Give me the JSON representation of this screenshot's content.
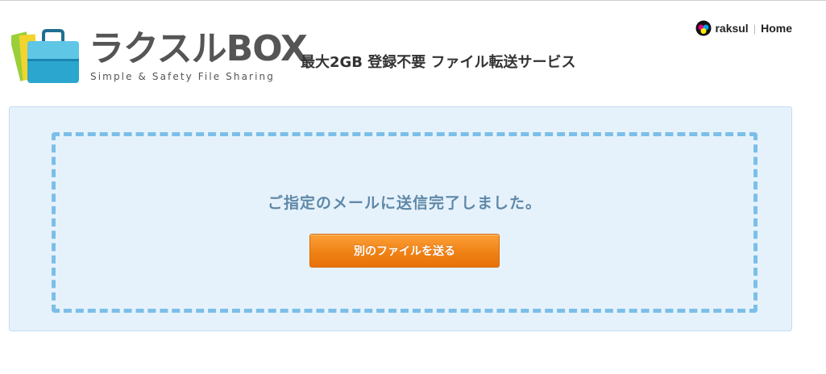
{
  "logo": {
    "name": "ラクスルBOX",
    "tagline": "Simple & Safety File Sharing",
    "icon": "briefcase-with-files-icon"
  },
  "header": {
    "service_description": "最大2GB 登録不要 ファイル転送サービス"
  },
  "nav": {
    "raksul_label": "raksul",
    "separator": "|",
    "home_label": "Home",
    "raksul_icon": "raksul-logo-icon"
  },
  "main": {
    "message": "ご指定のメールに送信完了しました。",
    "send_another_label": "別のファイルを送る"
  },
  "colors": {
    "panel_bg": "#e6f2fb",
    "dashed_border": "#7bbfe9",
    "message_text": "#5f88a8",
    "button_orange": "#f08215"
  }
}
